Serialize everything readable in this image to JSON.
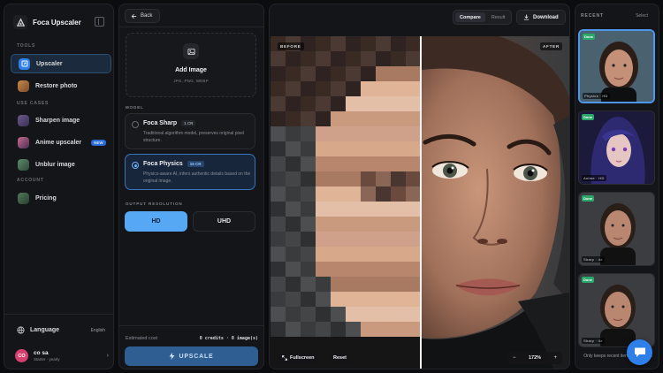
{
  "app": {
    "name": "Foca Upscaler"
  },
  "sidebar": {
    "tools_label": "TOOLS",
    "use_cases_label": "USE CASES",
    "account_label": "ACCOUNT",
    "tools": [
      {
        "label": "Upscaler",
        "icon": "upscaler-icon",
        "active": true
      },
      {
        "label": "Restore photo",
        "icon": "restore-photo-icon"
      }
    ],
    "use_cases": [
      {
        "label": "Sharpen image",
        "icon": "sharpen-icon"
      },
      {
        "label": "Anime upscaler",
        "icon": "anime-icon",
        "badge": "NEW"
      },
      {
        "label": "Unblur image",
        "icon": "unblur-icon"
      }
    ],
    "account": [
      {
        "label": "Pricing",
        "icon": "pricing-icon"
      }
    ],
    "language": {
      "label": "Language",
      "value": "English"
    },
    "user": {
      "initials": "CO",
      "name": "co sa",
      "plan": "Starter · yearly"
    }
  },
  "panel": {
    "back_label": "Back",
    "add_image": {
      "title": "Add Image",
      "formats": "JPG, PNG, WEBP"
    },
    "model_label": "MODEL",
    "models": [
      {
        "name": "Foca Sharp",
        "cost": "1 CR",
        "desc": "Traditional algorithm model, preserves original pixel structure.",
        "selected": false
      },
      {
        "name": "Foca Physics",
        "cost": "15 CR",
        "desc": "Physics-aware AI, infers authentic details based on the original image.",
        "selected": true
      }
    ],
    "resolution_label": "OUTPUT RESOLUTION",
    "resolutions": {
      "hd": "HD",
      "uhd": "UHD",
      "selected": "HD"
    },
    "estimated_cost_label": "Estimated cost",
    "estimated_cost_value": "0 credits · 0 image(s)",
    "upscale_label": "UPSCALE"
  },
  "viewer": {
    "tabs": [
      "Compare",
      "Result"
    ],
    "active_tab": "Compare",
    "download_label": "Download",
    "before_tag": "BEFORE",
    "after_tag": "AFTER",
    "fullscreen_label": "Fullscreen",
    "reset_label": "Reset",
    "zoom": "172%",
    "zoom_out": "−",
    "zoom_in": "+"
  },
  "recent": {
    "title": "RECENT",
    "select_label": "Select",
    "items": [
      {
        "status": "Done",
        "meta": "Physics · HD",
        "selected": true
      },
      {
        "status": "Done",
        "meta": "Anime · HD",
        "selected": false
      },
      {
        "status": "Done",
        "meta": "Sharp · 4×",
        "selected": false
      },
      {
        "status": "Done",
        "meta": "Sharp · 4×",
        "selected": false
      }
    ],
    "note": "Only keeps recent items within 24h"
  },
  "colors": {
    "accent": "#56a8f5",
    "selected_border": "#3a74bd",
    "done": "#2aa86b",
    "new_badge": "#2c6bd6"
  }
}
